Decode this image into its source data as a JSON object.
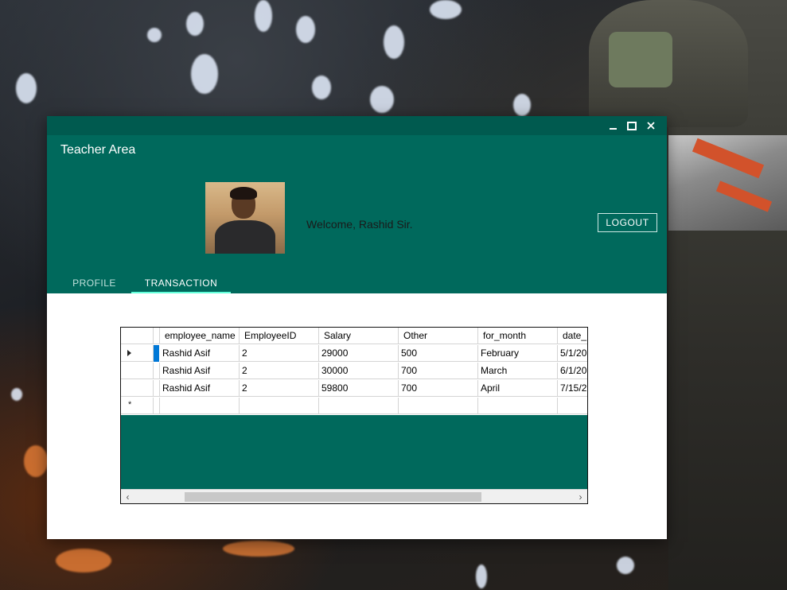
{
  "window": {
    "title": "Teacher Area",
    "controls": {
      "minimize": "minimize-icon",
      "maximize": "maximize-icon",
      "close": "close-icon"
    }
  },
  "header": {
    "welcome_text": "Welcome, Rashid Sir.",
    "logout_label": "LOGOUT"
  },
  "tabs": [
    {
      "label": "PROFILE",
      "active": false
    },
    {
      "label": "TRANSACTION",
      "active": true
    }
  ],
  "grid": {
    "columns": [
      "employee_name",
      "EmployeeID",
      "Salary",
      "Other",
      "for_month",
      "date_"
    ],
    "rows": [
      [
        "Rashid Asif",
        "2",
        "29000",
        "500",
        "February",
        "5/1/20"
      ],
      [
        "Rashid Asif",
        "2",
        "30000",
        "700",
        "March",
        "6/1/20"
      ],
      [
        "Rashid Asif",
        "2",
        "59800",
        "700",
        "April",
        "7/15/2"
      ]
    ]
  },
  "colors": {
    "primary": "#00695c",
    "titlebar": "#005a4f",
    "tab_indicator": "#64ffda",
    "selection": "#0078d7"
  }
}
